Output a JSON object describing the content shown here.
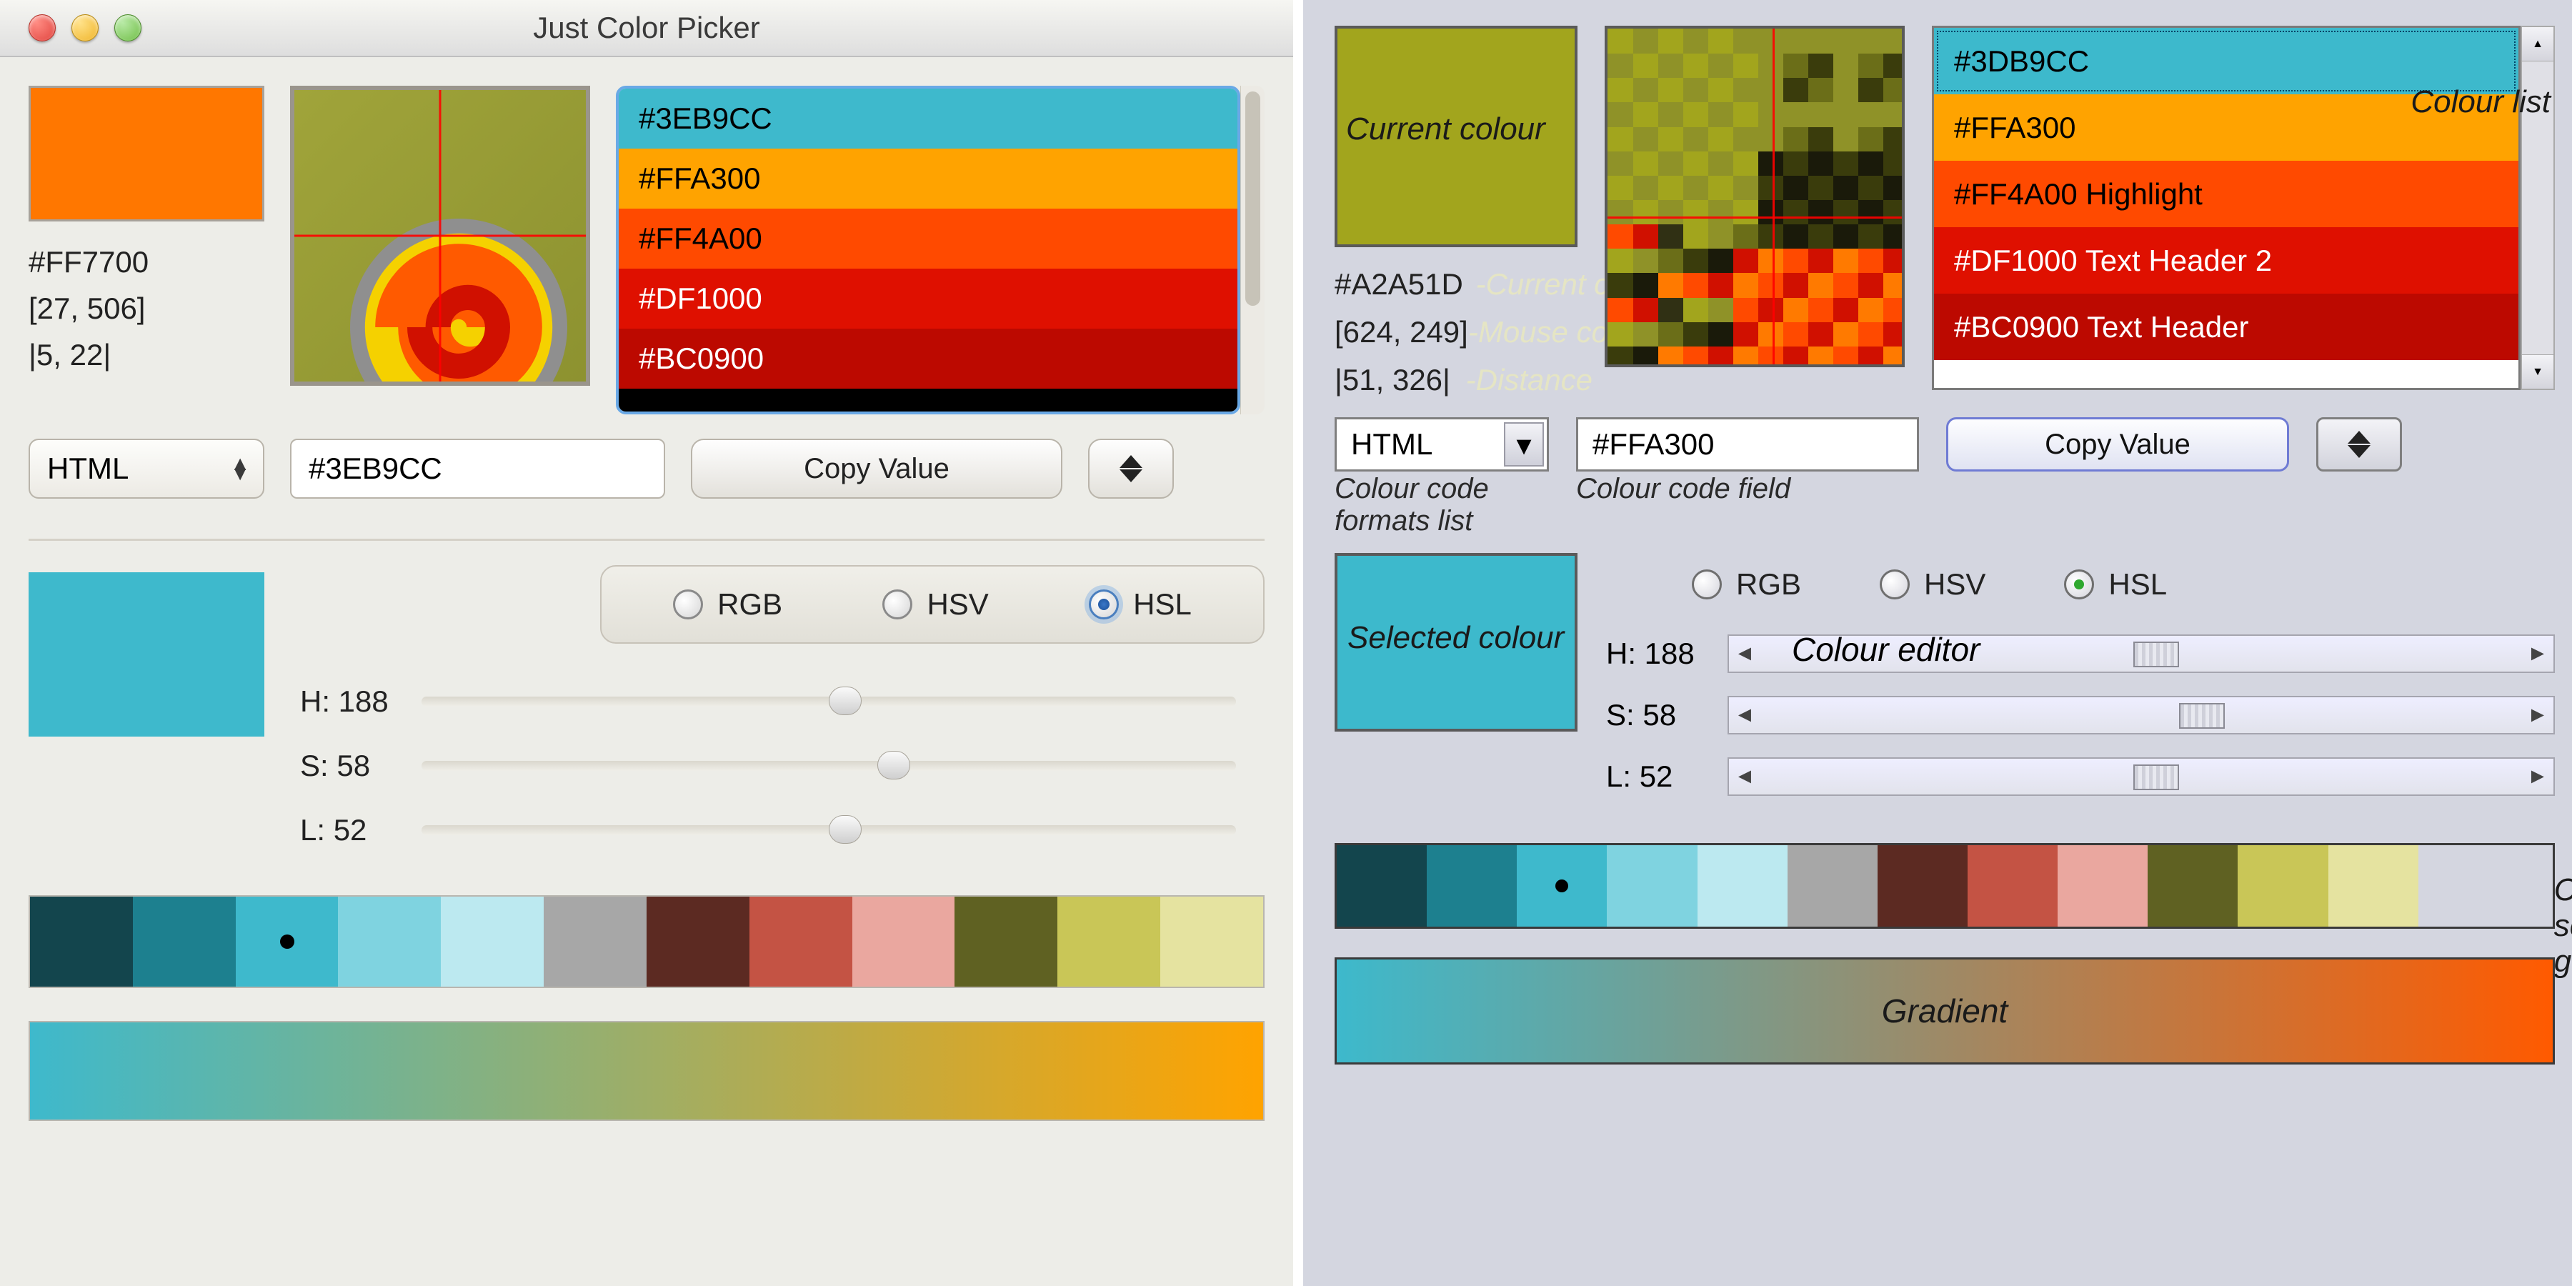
{
  "left": {
    "title": "Just Color Picker",
    "current_swatch": "#FF7700",
    "current_code": "#FF7700",
    "mouse_coords": "[27, 506]",
    "distance": "|5, 22|",
    "format_selected": "HTML",
    "code_field": "#3EB9CC",
    "copy_label": "Copy Value",
    "color_list": [
      {
        "hex": "#3EB9CC",
        "label": "#3EB9CC",
        "text_light": false
      },
      {
        "hex": "#FFA300",
        "label": "#FFA300",
        "text_light": false
      },
      {
        "hex": "#FF4A00",
        "label": "#FF4A00",
        "text_light": false
      },
      {
        "hex": "#DF1000",
        "label": "#DF1000",
        "text_light": true
      },
      {
        "hex": "#BC0900",
        "label": "#BC0900",
        "text_light": true
      },
      {
        "hex": "#000000",
        "label": "",
        "text_light": true
      }
    ],
    "selected_swatch": "#3EB9CC",
    "modes": {
      "rgb": "RGB",
      "hsv": "HSV",
      "hsl": "HSL",
      "selected": "HSL"
    },
    "sliders": {
      "h_label": "H: 188",
      "s_label": "S: 58",
      "l_label": "L: 52",
      "h": 188,
      "s": 58,
      "l": 52
    },
    "scheme": [
      "#13454d",
      "#1d808f",
      "#3eb9cc",
      "#7fd3e0",
      "#bce9f0",
      "#a7a7a7",
      "#5c2a22",
      "#c45344",
      "#eaa79f",
      "#5f6122",
      "#c9c657",
      "#e5e3a0"
    ],
    "gradient_from": "#3EB9CC",
    "gradient_to": "#FFA300"
  },
  "right": {
    "labels": {
      "current_colour": "Current colour",
      "current_code": "Current colour code",
      "mouse": "Mouse coordinates",
      "distance": "Distance",
      "formats_list": "Colour code formats list",
      "code_field": "Colour code field",
      "colour_list": "Colour list",
      "selected_colour": "Selected colour",
      "colour_editor": "Colour editor",
      "scheme": "Colour scheme generator",
      "gradient": "Gradient"
    },
    "current_swatch": "#A2A51D",
    "current_code": "#A2A51D",
    "mouse_coords": "[624, 249]",
    "distance": "|51, 326|",
    "format_selected": "HTML",
    "code_field": "#FFA300",
    "copy_label": "Copy Value",
    "color_list": [
      {
        "hex": "#3DB9CC",
        "label": "#3DB9CC",
        "selected": true
      },
      {
        "hex": "#FFA300",
        "label": "#FFA300"
      },
      {
        "hex": "#FF4A00",
        "label": "#FF4A00 Highlight"
      },
      {
        "hex": "#DF1000",
        "label": "#DF1000 Text Header 2"
      },
      {
        "hex": "#BC0900",
        "label": "#BC0900 Text Header"
      }
    ],
    "selected_swatch": "#3DB9CC",
    "modes": {
      "rgb": "RGB",
      "hsv": "HSV",
      "hsl": "HSL",
      "selected": "HSL"
    },
    "sliders": {
      "h_label": "H: 188",
      "s_label": "S: 58",
      "l_label": "L: 52",
      "h": 188,
      "s": 58,
      "l": 52
    },
    "scheme": [
      "#13454d",
      "#1d808f",
      "#3eb9cc",
      "#7fd3e0",
      "#bce9f0",
      "#a7a7a7",
      "#5c2a22",
      "#c45344",
      "#eaa79f",
      "#5f6122",
      "#c9c657",
      "#e5e3a0"
    ],
    "gradient_from": "#3DB9CC",
    "gradient_to": "#FF5A00"
  }
}
